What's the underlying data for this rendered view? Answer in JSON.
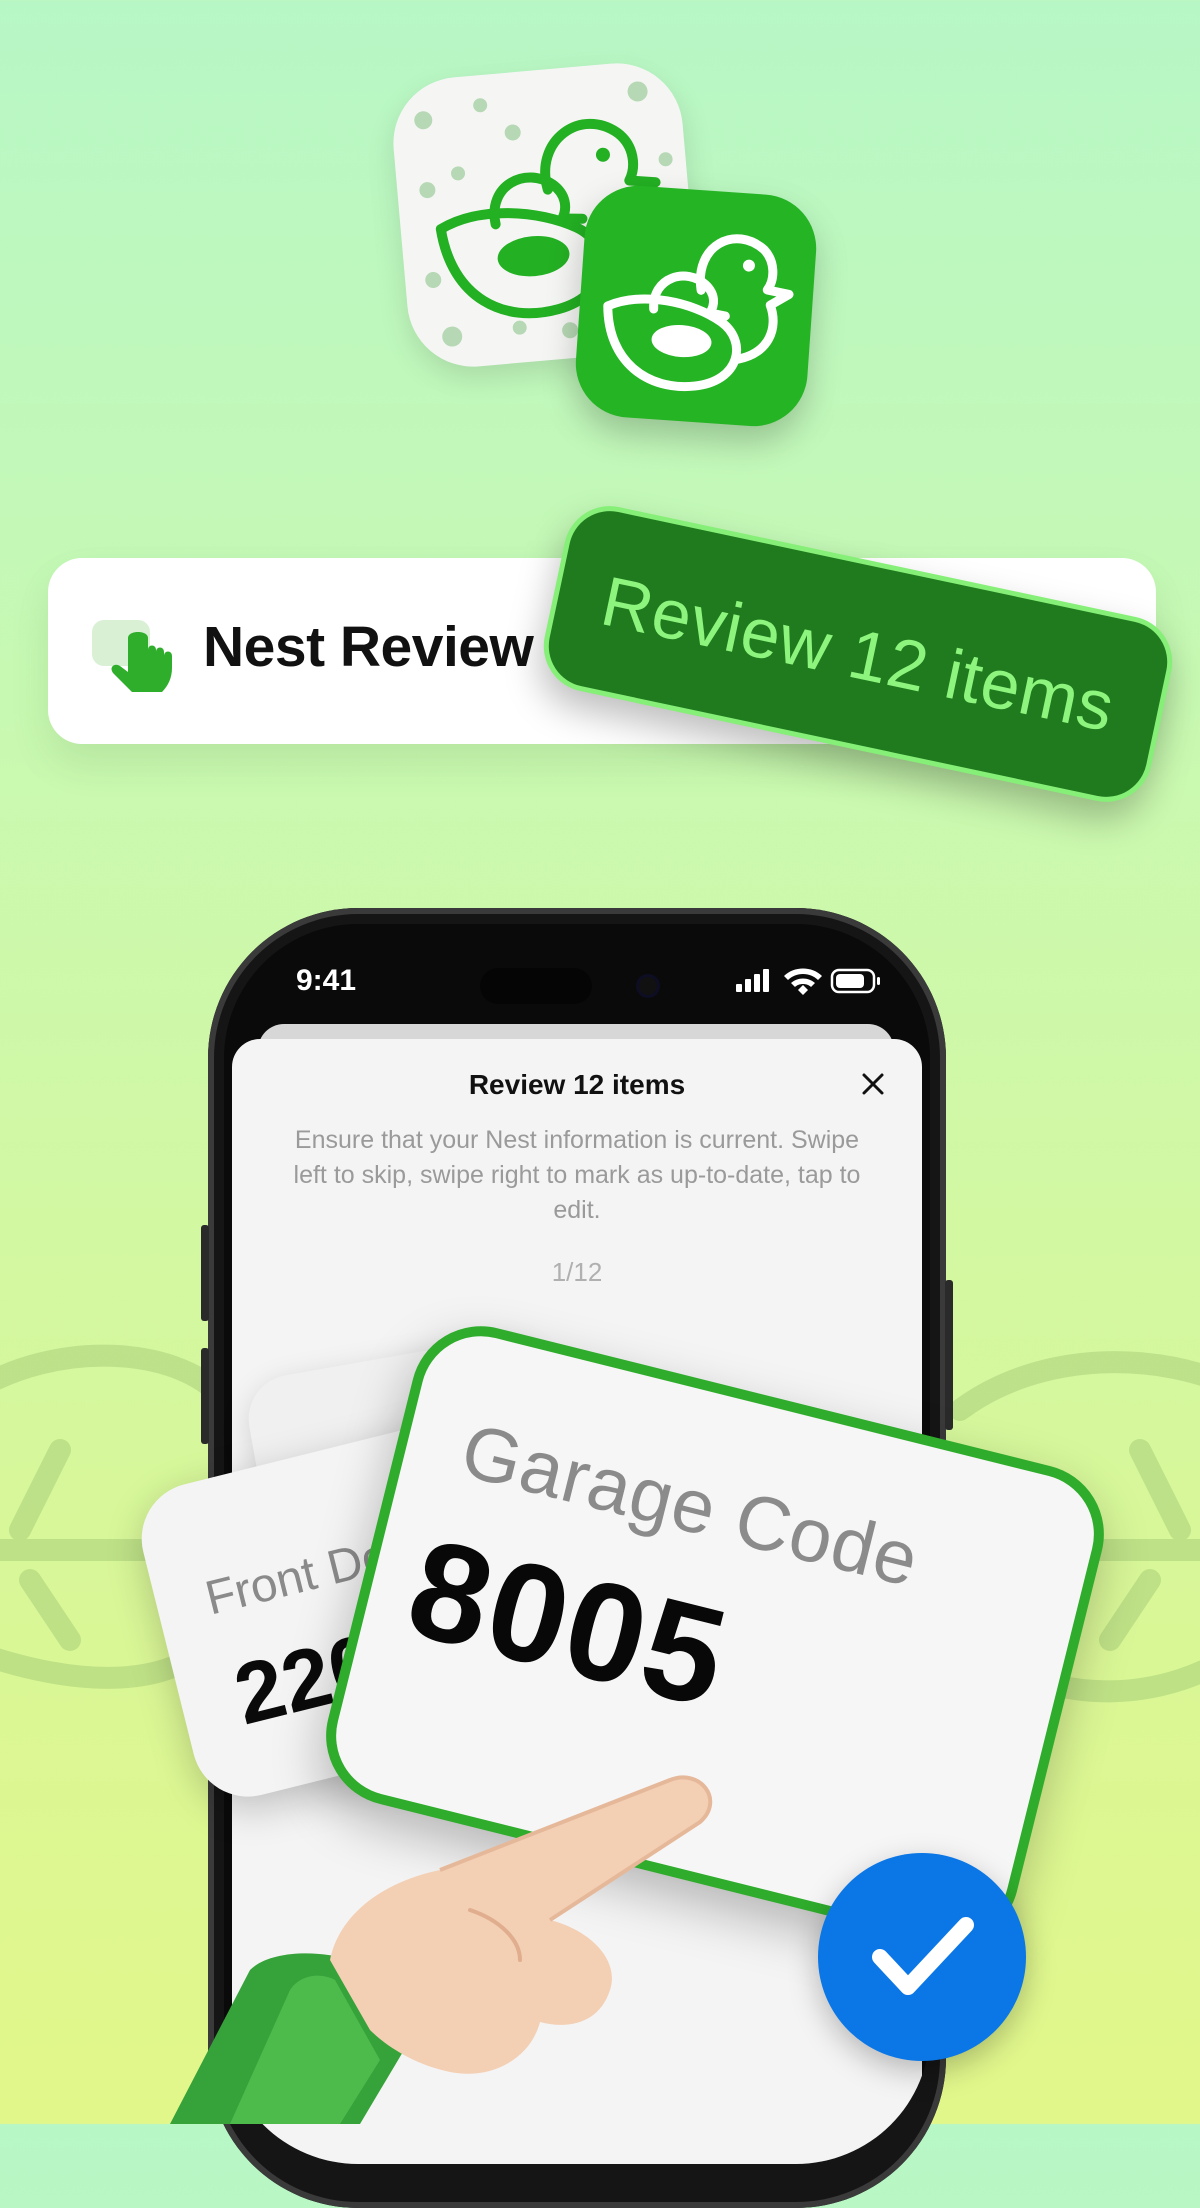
{
  "app": {
    "icons": [
      "duck-app-icon-light",
      "duck-app-icon-green"
    ]
  },
  "nest_bar": {
    "title": "Nest Review",
    "icon": "tap-hand-icon"
  },
  "badge": {
    "label": "Review 12 items"
  },
  "phone": {
    "status": {
      "time": "9:41",
      "icons": [
        "signal-icon",
        "wifi-icon",
        "battery-icon"
      ]
    },
    "sheet": {
      "title": "Review 12 items",
      "description": "Ensure that your Nest information is current. Swipe left to skip, swipe right to mark as up-to-date, tap to edit.",
      "counter": "1/12",
      "close_icon": "close-icon"
    }
  },
  "cards": {
    "back": {
      "label": "Front Do",
      "value": "220"
    },
    "front": {
      "label": "Garage Code",
      "value": "8005"
    }
  },
  "confirm": {
    "icon": "checkmark-icon"
  },
  "colors": {
    "brand_green": "#25b424",
    "dark_green": "#1f7b1e",
    "light_green_text": "#8df57d",
    "confirm_blue": "#0b77e6"
  }
}
